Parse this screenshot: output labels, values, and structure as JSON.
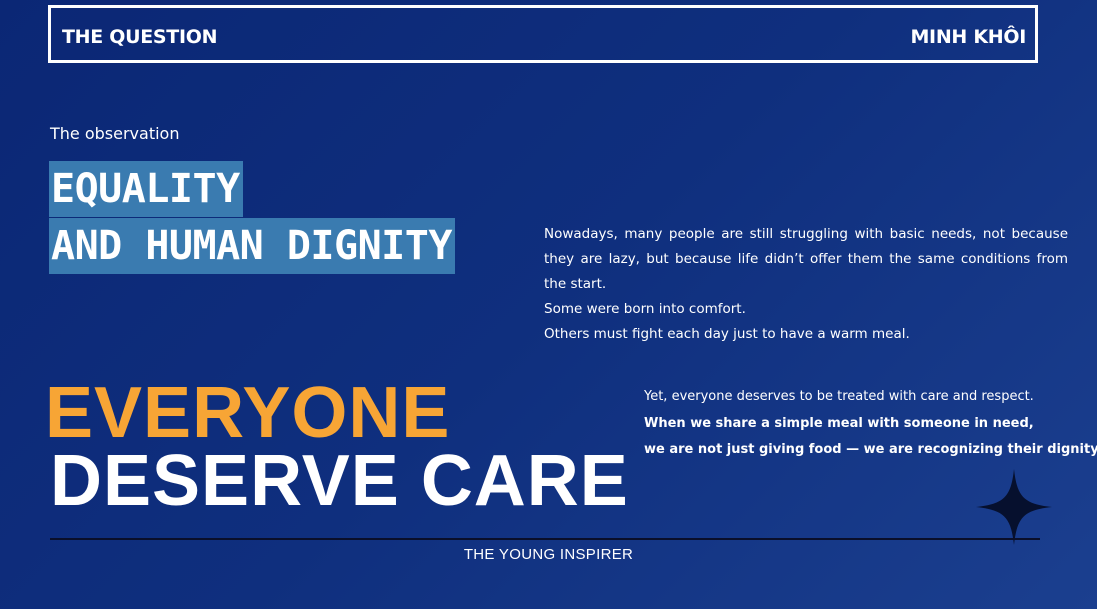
{
  "header": {
    "title": "THE QUESTION",
    "author": "MINH KHÔI"
  },
  "observation_label": "The observation",
  "headline": {
    "line1": "EQUALITY",
    "line2": "AND HUMAN DIGNITY"
  },
  "paragraph": [
    "Nowadays, many people are still struggling with basic needs, not because they are lazy, but because life didn’t offer them the same conditions from the start.",
    "Some were born into comfort.",
    "Others must fight each day just to have a warm meal."
  ],
  "big_statement": {
    "line1": "EVERYONE",
    "line2": "DESERVE CARE"
  },
  "paragraph2": {
    "line1": "Yet, everyone deserves to be treated with care and respect.",
    "line2": "When we share a simple meal with someone in need,",
    "line3": "we are not just giving food — we are recognizing their dignity."
  },
  "footer": "THE YOUNG INSPIRER",
  "colors": {
    "background": "#0f2f7e",
    "highlight": "#3a7bb0",
    "accent": "#f7a535"
  },
  "icons": [
    "four-point-star-icon"
  ]
}
